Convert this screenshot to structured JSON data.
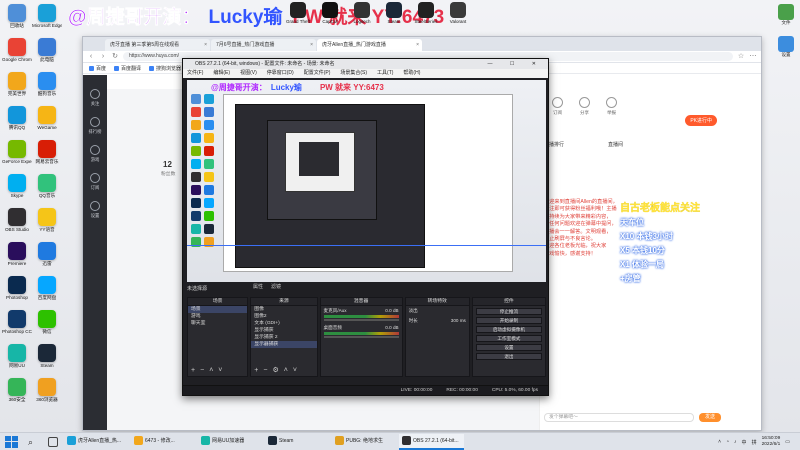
{
  "overlay": {
    "part1": "@周捷哥开演：",
    "part2": "Lucky瑜",
    "part3": "PW 就来 YY:6473"
  },
  "desktop_icons": [
    {
      "label": "回收站",
      "color": "#4f8fd8",
      "icon": "recycle-bin-icon"
    },
    {
      "label": "Microsoft Edge",
      "color": "#1aa0d8",
      "icon": "edge-icon"
    },
    {
      "label": "Google Chrome",
      "color": "#e94335",
      "icon": "chrome-icon"
    },
    {
      "label": "此电脑",
      "color": "#3a7bd5",
      "icon": "computer-icon"
    },
    {
      "label": "完美世界",
      "color": "#f2a71b",
      "icon": "game-icon"
    },
    {
      "label": "酷狗音乐",
      "color": "#2a8ef0",
      "icon": "music-icon"
    },
    {
      "label": "腾讯QQ",
      "color": "#1296db",
      "icon": "qq-icon"
    },
    {
      "label": "WeGame",
      "color": "#f6b515",
      "icon": "wegame-icon"
    },
    {
      "label": "GeForce Experience",
      "color": "#76b900",
      "icon": "geforce-icon"
    },
    {
      "label": "网易云音乐",
      "color": "#d81e06",
      "icon": "netease-music-icon"
    },
    {
      "label": "Skype",
      "color": "#00aff0",
      "icon": "skype-icon"
    },
    {
      "label": "QQ音乐",
      "color": "#31c27c",
      "icon": "qq-music-icon"
    },
    {
      "label": "OBS Studio",
      "color": "#302e31",
      "icon": "obs-icon"
    },
    {
      "label": "YY语音",
      "color": "#f5c518",
      "icon": "yy-icon"
    },
    {
      "label": "Premiere",
      "color": "#2a0e5c",
      "icon": "premiere-icon"
    },
    {
      "label": "迅雷",
      "color": "#1f7ae0",
      "icon": "thunder-icon"
    },
    {
      "label": "Photoshop",
      "color": "#0a2a4f",
      "icon": "photoshop-icon"
    },
    {
      "label": "百度网盘",
      "color": "#06a7ff",
      "icon": "baidu-pan-icon"
    },
    {
      "label": "Photoshop CC",
      "color": "#113a6b",
      "icon": "photoshop-cc-icon"
    },
    {
      "label": "微信",
      "color": "#2dc100",
      "icon": "wechat-icon"
    },
    {
      "label": "网易UU",
      "color": "#17b6a7",
      "icon": "uu-icon"
    },
    {
      "label": "Steam",
      "color": "#1b2838",
      "icon": "steam-icon"
    },
    {
      "label": "360安全",
      "color": "#35b558",
      "icon": "security-icon"
    },
    {
      "label": "360浏览器",
      "color": "#f0a020",
      "icon": "browser-icon"
    }
  ],
  "top_icons": [
    {
      "label": "Grand Theft",
      "color": "#222222"
    },
    {
      "label": "CapCut",
      "color": "#111111"
    },
    {
      "label": "Logitech",
      "color": "#333333"
    },
    {
      "label": "Steam",
      "color": "#1b2838"
    },
    {
      "label": "SteelSeries",
      "color": "#222222"
    },
    {
      "label": "Valorant",
      "color": "#3a3a3a"
    }
  ],
  "right_icons": [
    {
      "label": "文件",
      "color": "#4aa04a"
    },
    {
      "label": "设置",
      "color": "#3c8dde"
    }
  ],
  "browser": {
    "tabs": [
      {
        "label": "虎牙直播 第三季第5周在线观看",
        "active": false
      },
      {
        "label": "7月6号直播_热门游戏直播",
        "active": false
      },
      {
        "label": "虎牙Allen直播_热门游戏直播",
        "active": true
      }
    ],
    "url": "https://www.huya.com/",
    "bookmarks": [
      "百度",
      "百度翻译",
      "搜狗浏览器",
      "华为",
      "腾讯视频",
      "爱奇艺",
      "其他收藏夹"
    ],
    "viewer_count": "12",
    "viewer_label": "粉丝数"
  },
  "page_strip": [
    "关注",
    "排行榜",
    "游戏",
    "订阅",
    "设置"
  ],
  "side_panel": {
    "buttons": [
      "订阅",
      "分享",
      "举报"
    ],
    "pk": "PK进行中",
    "tabs": [
      "主播排行",
      "直播间"
    ],
    "chat_lines": [
      "欢迎来到直播间Allen的直播间，",
      "关注即可获得粉丝福利哦！主播",
      "将持续为大家带来精彩内容，",
      "有任何问题欢迎在弹幕中提问，",
      "主播会一一解答。文明观看，",
      "禁止刷屏与不良言论。",
      "欢迎各位老板光临，祝大家",
      "游戏愉快，感谢支持！"
    ],
    "promo_title": "自古老板能点关注",
    "promo_lines": [
      "天车位",
      "X10 本钱3小时",
      "X5 本钱10分",
      "X1 体验一局",
      "+房管"
    ],
    "input_placeholder": "发个弹幕吧～",
    "send": "发送"
  },
  "obs": {
    "title": "OBS 27.2.1 (64-bit, windows) - 配置文件: 未命名 - 场景: 未命名",
    "menu": [
      "文件(F)",
      "编辑(E)",
      "视图(V)",
      "停靠窗口(D)",
      "配置文件(P)",
      "场景集合(S)",
      "工具(T)",
      "帮助(H)"
    ],
    "source_label": "未选择源",
    "props": [
      "属性",
      "滤镜"
    ],
    "docks": {
      "scenes": {
        "title": "场景",
        "items": [
          "场景",
          "游戏",
          "聊天室"
        ]
      },
      "sources": {
        "title": "来源",
        "items": [
          "图像",
          "图像2",
          "文本 (GDI+)",
          "显示捕获",
          "显示捕获 2",
          "显示器捕获"
        ]
      },
      "mixer": {
        "title": "混音器",
        "channels": [
          {
            "name": "麦克风/Aux",
            "db": "0.0 dB"
          },
          {
            "name": "桌面音频",
            "db": "0.0 dB"
          }
        ]
      },
      "transitions": {
        "title": "转场特效",
        "rows": [
          [
            "淡出",
            ""
          ],
          [
            "时长",
            "300 ms"
          ]
        ]
      },
      "controls": {
        "title": "控件",
        "buttons": [
          "停止推流",
          "开始录制",
          "启动虚拟摄像机",
          "工作室模式",
          "设置",
          "退出"
        ]
      }
    },
    "status": [
      "LIVE: 00:00:00",
      "REC: 00:00:00",
      "CPU: 5.0%, 60.00 fps"
    ]
  },
  "taskbar": {
    "items": [
      {
        "label": "虎牙Allen直播_热...",
        "color": "#1aa0d8",
        "active": false
      },
      {
        "label": "6473 - 修改...",
        "color": "#f2a71b",
        "active": false
      },
      {
        "label": "网易UU加速器",
        "color": "#17b6a7",
        "active": false
      },
      {
        "label": "Steam",
        "color": "#1b2838",
        "active": false
      },
      {
        "label": "PUBG: 绝地求生",
        "color": "#e0a020",
        "active": false
      },
      {
        "label": "OBS 27.2.1 (64-bit...",
        "color": "#302e31",
        "active": true
      }
    ],
    "tray": [
      "中",
      "拼"
    ],
    "time": "16:50:09",
    "date": "2022/6/1"
  }
}
